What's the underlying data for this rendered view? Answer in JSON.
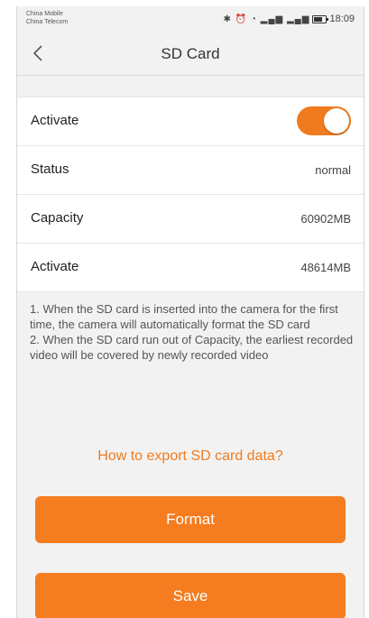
{
  "status_bar": {
    "carrier1": "China Mobile",
    "carrier2": "China Telecom",
    "icons": "✱ ⏰ ◔ ▂▄▆ ▂▄▆",
    "time": "18:09"
  },
  "nav": {
    "title": "SD Card",
    "back_icon": "chevron-left-icon"
  },
  "settings": {
    "activate_toggle_label": "Activate",
    "activate_toggle_on": true,
    "status_label": "Status",
    "status_value": "normal",
    "capacity_label": "Capacity",
    "capacity_value": "60902MB",
    "activate_label": "Activate",
    "activate_value": "48614MB"
  },
  "notes": {
    "line1": "1. When the SD card is inserted into the camera for the first time, the camera will automatically format the SD card",
    "line2": "2. When the SD card run out of Capacity, the earliest recorded video will be covered by newly recorded video"
  },
  "export_link": "How to export SD card data?",
  "buttons": {
    "format": "Format",
    "save": "Save"
  },
  "colors": {
    "accent": "#f57c1f",
    "background": "#f2f2f2"
  }
}
